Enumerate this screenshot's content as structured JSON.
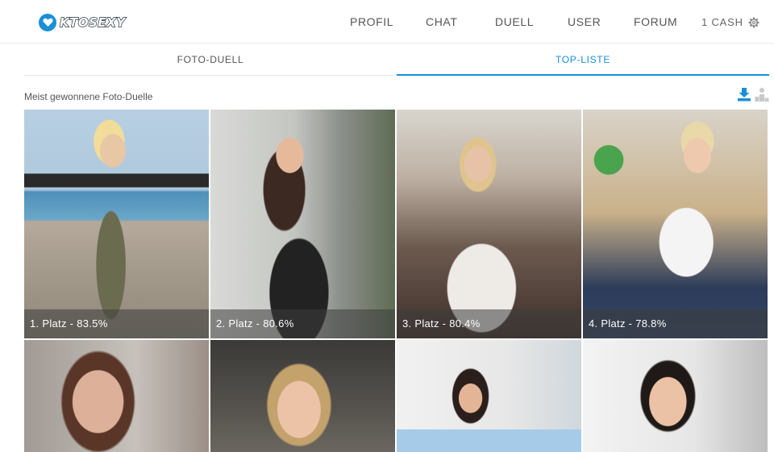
{
  "brand": {
    "name": "KTOSEXY",
    "accent": "#1a8fd8"
  },
  "nav": {
    "items": [
      {
        "label": "PROFIL"
      },
      {
        "label": "CHAT"
      },
      {
        "label": "DUELL"
      },
      {
        "label": "USER"
      },
      {
        "label": "FORUM"
      }
    ],
    "cash_label": "1 CASH",
    "settings_icon": "gear-icon"
  },
  "tabs": [
    {
      "label": "FOTO-DUELL",
      "active": false
    },
    {
      "label": "TOP-LISTE",
      "active": true
    }
  ],
  "section": {
    "title": "Meist gewonnene Foto-Duelle",
    "icons": [
      "download-icon",
      "ranking-icon"
    ]
  },
  "photos": [
    {
      "caption": "1. Platz - 83.5%"
    },
    {
      "caption": "2. Platz - 80.6%"
    },
    {
      "caption": "3. Platz - 80.4%"
    },
    {
      "caption": "4. Platz - 78.8%"
    },
    {
      "caption": ""
    },
    {
      "caption": ""
    },
    {
      "caption": ""
    },
    {
      "caption": ""
    }
  ]
}
